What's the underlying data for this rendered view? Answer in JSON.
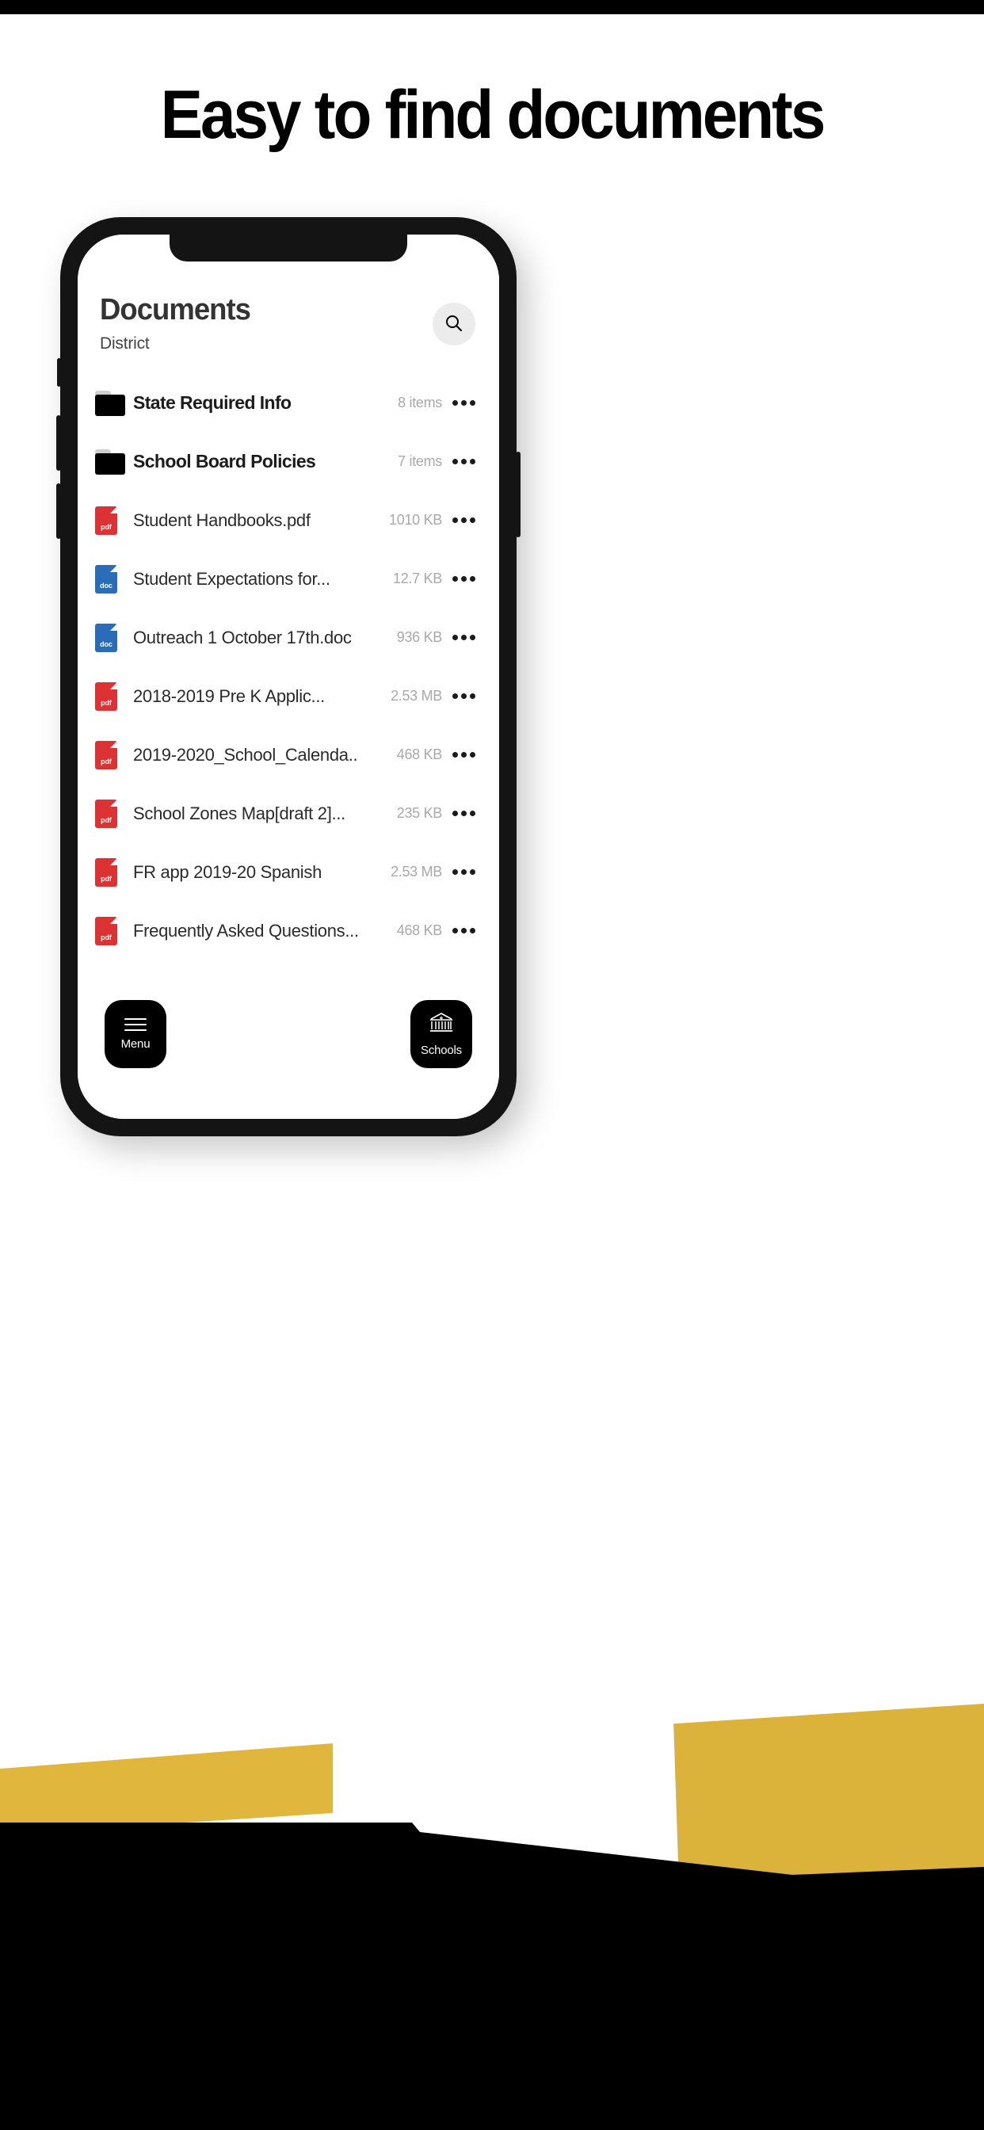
{
  "headline": "Easy to find documents",
  "app": {
    "title": "Documents",
    "subtitle": "District",
    "search_icon": "search-icon",
    "items": [
      {
        "type": "folder",
        "name": "State Required Info",
        "meta": "8 items",
        "icon": "folder-icon"
      },
      {
        "type": "folder",
        "name": "School Board Policies",
        "meta": "7 items",
        "icon": "folder-icon"
      },
      {
        "type": "pdf",
        "name": "Student Handbooks.pdf",
        "meta": "1010 KB",
        "icon": "pdf-file-icon",
        "icon_label": "pdf"
      },
      {
        "type": "doc",
        "name": "Student Expectations for...",
        "meta": "12.7 KB",
        "icon": "doc-file-icon",
        "icon_label": "doc"
      },
      {
        "type": "doc",
        "name": "Outreach 1 October 17th.doc",
        "meta": "936 KB",
        "icon": "doc-file-icon",
        "icon_label": "doc"
      },
      {
        "type": "pdf",
        "name": "2018-2019 Pre K Applic...",
        "meta": "2.53 MB",
        "icon": "pdf-file-icon",
        "icon_label": "pdf"
      },
      {
        "type": "pdf",
        "name": "2019-2020_School_Calenda..",
        "meta": "468 KB",
        "icon": "pdf-file-icon",
        "icon_label": "pdf"
      },
      {
        "type": "pdf",
        "name": "School Zones Map[draft 2]...",
        "meta": "235 KB",
        "icon": "pdf-file-icon",
        "icon_label": "pdf"
      },
      {
        "type": "pdf",
        "name": "FR app 2019-20 Spanish",
        "meta": "2.53 MB",
        "icon": "pdf-file-icon",
        "icon_label": "pdf"
      },
      {
        "type": "pdf",
        "name": "Frequently Asked Questions...",
        "meta": "468 KB",
        "icon": "pdf-file-icon",
        "icon_label": "pdf"
      }
    ],
    "footer": {
      "menu_label": "Menu",
      "menu_icon": "hamburger-menu-icon",
      "schools_label": "Schools",
      "schools_icon": "school-building-icon"
    }
  },
  "colors": {
    "pdf_red": "#DB3333",
    "doc_blue": "#2A6CB8",
    "accent_gold": "#E0B73C",
    "phone_frame": "#141414",
    "meta_gray": "#A9A9A9"
  }
}
